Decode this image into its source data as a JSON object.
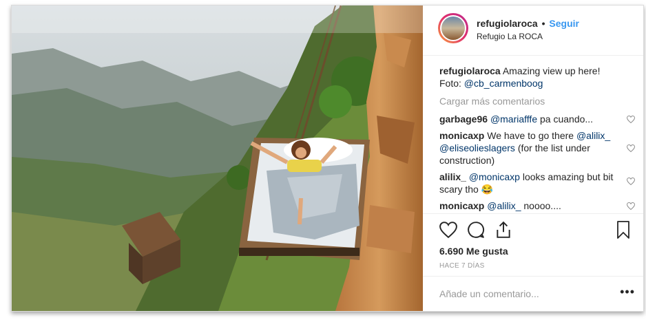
{
  "post": {
    "photo_alt": "Bed hanging off a cliff over a mountain valley",
    "username": "refugiolaroca",
    "separator": "•",
    "follow_label": "Seguir",
    "location": "Refugio La ROCA",
    "caption": {
      "user": "refugiolaroca",
      "text": "Amazing view up here!",
      "credit_prefix": "Foto:",
      "credit_mention": "@cb_carmenboog"
    },
    "load_more": "Cargar más comentarios",
    "comments": [
      {
        "user": "garbage96",
        "mention": "@mariafffe",
        "text": "pa cuando..."
      },
      {
        "user": "monicaxp",
        "text": "We have to go there",
        "mention": "@alilix_",
        "mention2": "@eliseolieslagers",
        "text2": "(for the list under construction)"
      },
      {
        "user": "alilix_",
        "mention": "@monicaxp",
        "text": "looks amazing but bit scary tho 😂"
      },
      {
        "user": "monicaxp",
        "mention": "@alilix_",
        "text": "noooo...."
      }
    ],
    "likes": "6.690 Me gusta",
    "time": "HACE 7 DÍAS",
    "comment_placeholder": "Añade un comentario...",
    "more_label": "•••"
  }
}
